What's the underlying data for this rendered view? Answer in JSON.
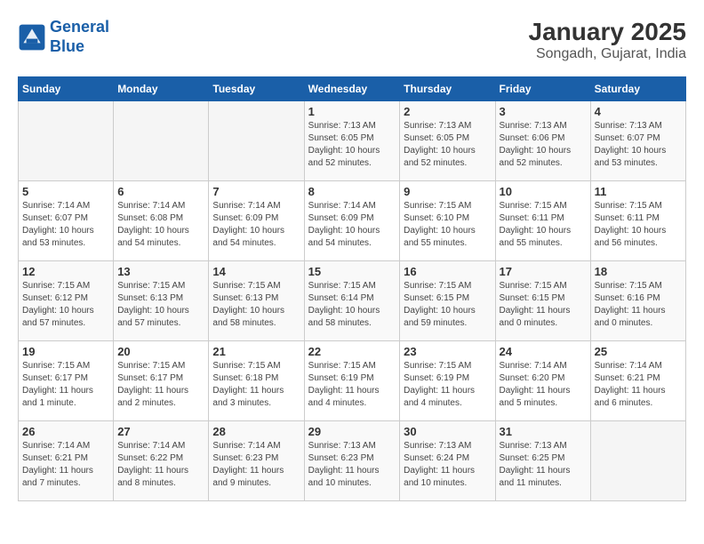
{
  "logo": {
    "line1": "General",
    "line2": "Blue"
  },
  "title": "January 2025",
  "subtitle": "Songadh, Gujarat, India",
  "days_header": [
    "Sunday",
    "Monday",
    "Tuesday",
    "Wednesday",
    "Thursday",
    "Friday",
    "Saturday"
  ],
  "weeks": [
    [
      {
        "day": "",
        "info": ""
      },
      {
        "day": "",
        "info": ""
      },
      {
        "day": "",
        "info": ""
      },
      {
        "day": "1",
        "info": "Sunrise: 7:13 AM\nSunset: 6:05 PM\nDaylight: 10 hours\nand 52 minutes."
      },
      {
        "day": "2",
        "info": "Sunrise: 7:13 AM\nSunset: 6:05 PM\nDaylight: 10 hours\nand 52 minutes."
      },
      {
        "day": "3",
        "info": "Sunrise: 7:13 AM\nSunset: 6:06 PM\nDaylight: 10 hours\nand 52 minutes."
      },
      {
        "day": "4",
        "info": "Sunrise: 7:13 AM\nSunset: 6:07 PM\nDaylight: 10 hours\nand 53 minutes."
      }
    ],
    [
      {
        "day": "5",
        "info": "Sunrise: 7:14 AM\nSunset: 6:07 PM\nDaylight: 10 hours\nand 53 minutes."
      },
      {
        "day": "6",
        "info": "Sunrise: 7:14 AM\nSunset: 6:08 PM\nDaylight: 10 hours\nand 54 minutes."
      },
      {
        "day": "7",
        "info": "Sunrise: 7:14 AM\nSunset: 6:09 PM\nDaylight: 10 hours\nand 54 minutes."
      },
      {
        "day": "8",
        "info": "Sunrise: 7:14 AM\nSunset: 6:09 PM\nDaylight: 10 hours\nand 54 minutes."
      },
      {
        "day": "9",
        "info": "Sunrise: 7:15 AM\nSunset: 6:10 PM\nDaylight: 10 hours\nand 55 minutes."
      },
      {
        "day": "10",
        "info": "Sunrise: 7:15 AM\nSunset: 6:11 PM\nDaylight: 10 hours\nand 55 minutes."
      },
      {
        "day": "11",
        "info": "Sunrise: 7:15 AM\nSunset: 6:11 PM\nDaylight: 10 hours\nand 56 minutes."
      }
    ],
    [
      {
        "day": "12",
        "info": "Sunrise: 7:15 AM\nSunset: 6:12 PM\nDaylight: 10 hours\nand 57 minutes."
      },
      {
        "day": "13",
        "info": "Sunrise: 7:15 AM\nSunset: 6:13 PM\nDaylight: 10 hours\nand 57 minutes."
      },
      {
        "day": "14",
        "info": "Sunrise: 7:15 AM\nSunset: 6:13 PM\nDaylight: 10 hours\nand 58 minutes."
      },
      {
        "day": "15",
        "info": "Sunrise: 7:15 AM\nSunset: 6:14 PM\nDaylight: 10 hours\nand 58 minutes."
      },
      {
        "day": "16",
        "info": "Sunrise: 7:15 AM\nSunset: 6:15 PM\nDaylight: 10 hours\nand 59 minutes."
      },
      {
        "day": "17",
        "info": "Sunrise: 7:15 AM\nSunset: 6:15 PM\nDaylight: 11 hours\nand 0 minutes."
      },
      {
        "day": "18",
        "info": "Sunrise: 7:15 AM\nSunset: 6:16 PM\nDaylight: 11 hours\nand 0 minutes."
      }
    ],
    [
      {
        "day": "19",
        "info": "Sunrise: 7:15 AM\nSunset: 6:17 PM\nDaylight: 11 hours\nand 1 minute."
      },
      {
        "day": "20",
        "info": "Sunrise: 7:15 AM\nSunset: 6:17 PM\nDaylight: 11 hours\nand 2 minutes."
      },
      {
        "day": "21",
        "info": "Sunrise: 7:15 AM\nSunset: 6:18 PM\nDaylight: 11 hours\nand 3 minutes."
      },
      {
        "day": "22",
        "info": "Sunrise: 7:15 AM\nSunset: 6:19 PM\nDaylight: 11 hours\nand 4 minutes."
      },
      {
        "day": "23",
        "info": "Sunrise: 7:15 AM\nSunset: 6:19 PM\nDaylight: 11 hours\nand 4 minutes."
      },
      {
        "day": "24",
        "info": "Sunrise: 7:14 AM\nSunset: 6:20 PM\nDaylight: 11 hours\nand 5 minutes."
      },
      {
        "day": "25",
        "info": "Sunrise: 7:14 AM\nSunset: 6:21 PM\nDaylight: 11 hours\nand 6 minutes."
      }
    ],
    [
      {
        "day": "26",
        "info": "Sunrise: 7:14 AM\nSunset: 6:21 PM\nDaylight: 11 hours\nand 7 minutes."
      },
      {
        "day": "27",
        "info": "Sunrise: 7:14 AM\nSunset: 6:22 PM\nDaylight: 11 hours\nand 8 minutes."
      },
      {
        "day": "28",
        "info": "Sunrise: 7:14 AM\nSunset: 6:23 PM\nDaylight: 11 hours\nand 9 minutes."
      },
      {
        "day": "29",
        "info": "Sunrise: 7:13 AM\nSunset: 6:23 PM\nDaylight: 11 hours\nand 10 minutes."
      },
      {
        "day": "30",
        "info": "Sunrise: 7:13 AM\nSunset: 6:24 PM\nDaylight: 11 hours\nand 10 minutes."
      },
      {
        "day": "31",
        "info": "Sunrise: 7:13 AM\nSunset: 6:25 PM\nDaylight: 11 hours\nand 11 minutes."
      },
      {
        "day": "",
        "info": ""
      }
    ]
  ]
}
